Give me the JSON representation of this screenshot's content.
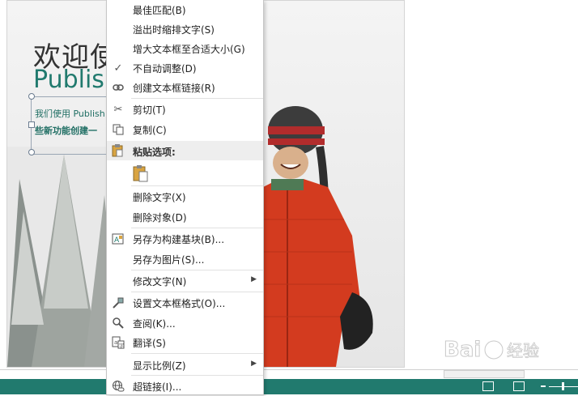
{
  "page": {
    "title_line1": "欢迎使",
    "title_line2": "Publis",
    "frame_line1": "我们使用 Publish",
    "frame_line2": "些新功能创建一"
  },
  "context_menu": {
    "items": [
      {
        "label": "最佳匹配(B)"
      },
      {
        "label": "溢出时缩排文字(S)"
      },
      {
        "label": "增大文本框至合适大小(G)"
      },
      {
        "label": "不自动调整(D)",
        "checked": true
      },
      {
        "label": "创建文本框链接(R)"
      },
      {
        "label": "剪切(T)"
      },
      {
        "label": "复制(C)"
      },
      {
        "label": "粘贴选项:"
      },
      {
        "label": "删除文字(X)"
      },
      {
        "label": "删除对象(D)"
      },
      {
        "label": "另存为构建基块(B)..."
      },
      {
        "label": "另存为图片(S)..."
      },
      {
        "label": "修改文字(N)",
        "submenu": true
      },
      {
        "label": "设置文本框格式(O)..."
      },
      {
        "label": "查阅(K)..."
      },
      {
        "label": "翻译(S)"
      },
      {
        "label": "显示比例(Z)",
        "submenu": true
      },
      {
        "label": "超链接(I)..."
      }
    ]
  },
  "colors": {
    "accent": "#217a6e",
    "coat_red": "#d33b1f"
  },
  "watermark": "Baidu经验"
}
